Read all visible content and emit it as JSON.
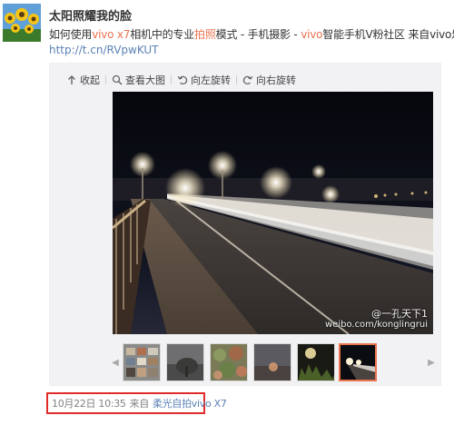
{
  "post": {
    "username": "太阳照耀我的脸",
    "text_parts": [
      "如何使用",
      "vivo x7",
      "相机中的专业",
      "拍照",
      "模式 - 手机摄影 - ",
      "vivo",
      "智能手机V粉社区 来自vivo乐园"
    ],
    "link": "http://t.cn/RVpwKUT"
  },
  "toolbar": {
    "collapse": "收起",
    "view_large": "查看大图",
    "rotate_left": "向左旋转",
    "rotate_right": "向右旋转"
  },
  "photo": {
    "watermark_handle": "@一孔天下1",
    "watermark_url": "weibo.com/konglingrui"
  },
  "meta": {
    "time": "10月22日 10:35",
    "from_label": "来自",
    "device": "柔光自拍vivo X7"
  },
  "colors": {
    "highlight": "#eb7350",
    "link": "#5b82b5",
    "annotation_box": "#e02b2b"
  },
  "icons": [
    "collapse-arrow-icon",
    "magnifier-icon",
    "rotate-left-icon",
    "rotate-right-icon",
    "chevron-left-icon",
    "chevron-right-icon"
  ]
}
